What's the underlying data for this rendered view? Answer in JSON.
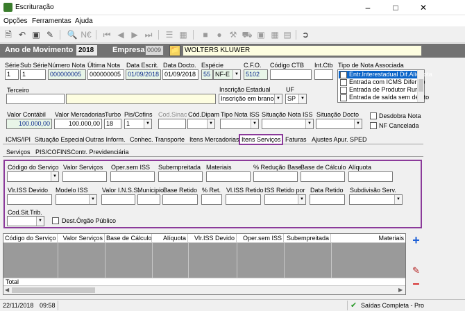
{
  "window": {
    "title": "Escrituração"
  },
  "menu": [
    "Opções",
    "Ferramentas",
    "Ajuda"
  ],
  "header": {
    "ano_label": "Ano de Movimento",
    "ano_value": "2018",
    "empresa_label": "Empresa",
    "empresa_code": "0009",
    "empresa_name": "WOLTERS KLUWER"
  },
  "row1": {
    "serie_label": "Série",
    "serie": "1",
    "subserie_label": "Sub Série",
    "subserie": "1",
    "numero_label": "Número Nota",
    "numero": "000000005",
    "ultima_label": "Última Nota",
    "ultima": "000000005",
    "data_escrit_label": "Data Escrit.",
    "data_escrit": "01/09/2018",
    "data_docto_label": "Data Docto.",
    "data_docto": "01/09/2018",
    "especie_label": "Espécie",
    "especie_code": "55",
    "especie": "NF-E",
    "cfo_label": "C.F.O.",
    "cfo": "5102",
    "ctb_label": "Código CTB",
    "int_ctb_label": "Int.Ctb",
    "tipo_nota_label": "Tipo de Nota Associada",
    "tipo_nota_items": [
      "Entr.Interestadual Dif.Alíquota",
      "Entrada com ICMS Diferido",
      "Entrada de Produtor Rural",
      "Entrada de saída sem débito"
    ]
  },
  "row2": {
    "terceiro_label": "Terceiro",
    "inscricao_label": "Inscrição Estadual",
    "inscricao": "Inscrição em branco",
    "uf_label": "UF",
    "uf": "SP"
  },
  "row3": {
    "valor_contabil_label": "Valor Contábil",
    "valor_contabil": "100.000,00",
    "valor_merc_label": "Valor Mercadorias",
    "valor_merc": "100.000,00",
    "turbo_label": "Turbo",
    "turbo": "18",
    "pis_label": "Pis/Cofins",
    "pis": "1",
    "cod_sinac_label": "Cod.Sinac",
    "cod_dipam_label": "Cód.Dipam",
    "tipo_iss_label": "Tipo Nota ISS",
    "sit_iss_label": "Situação Nota ISS",
    "sit_docto_label": "Situação Docto",
    "desdobra_label": "Desdobra Nota",
    "nf_cancelada_label": "NF Cancelada"
  },
  "tabs": [
    "ICMS/IPI",
    "Situação Especial",
    "Outras Inform.",
    "Conhec. Transporte",
    "Itens Mercadorias",
    "Itens Serviços",
    "Faturas",
    "Ajustes Apur. SPED"
  ],
  "subtabs": [
    "Serviços",
    "PIS/COFINS",
    "Contr. Previdenciária"
  ],
  "servicos": {
    "codigo_servico": "Código do Serviço",
    "valor_servicos": "Valor Serviços",
    "oper_sem_iss": "Oper.sem ISS",
    "subempreitada": "Subempreitada",
    "materiais": "Materiais",
    "reducao_base": "% Redução Base",
    "base_calculo": "Base de Cálculo",
    "aliquota": "Alíquota",
    "vlr_iss_devido": "Vlr.ISS Devido",
    "modelo_iss": "Modelo ISS",
    "valor_inss": "Valor I.N.S.S.",
    "municipio": "Municipio",
    "base_retido": "Base Retido",
    "pct_ret": "% Ret.",
    "vl_iss_retido": "Vl.ISS Retido",
    "iss_retido_por": "ISS Retido por",
    "data_retido": "Data Retido",
    "subdivisao": "Subdivisão Serv.",
    "cod_sit_trib": "Cod.Sit.Trib.",
    "dest_orgao": "Dest.Órgão Público"
  },
  "grid": {
    "columns": [
      "Código do Serviço",
      "Valor Serviços",
      "Base de Cálculo",
      "Alíquota",
      "Vlr.ISS Devido",
      "Oper.sem ISS",
      "Subempreitada",
      "Materiais"
    ],
    "total_label": "Total"
  },
  "status": {
    "date": "22/11/2018",
    "time": "09:58",
    "message": "Saídas Completa - Pro"
  }
}
